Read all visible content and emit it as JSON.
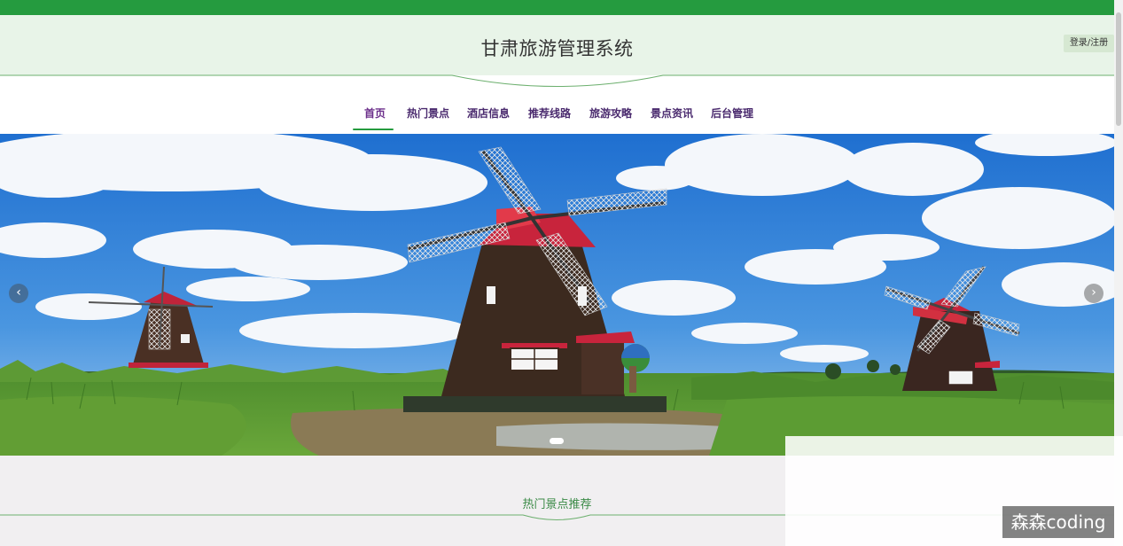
{
  "header": {
    "site_title": "甘肃旅游管理系统",
    "login_label": "登录/注册"
  },
  "nav": {
    "items": [
      {
        "label": "首页",
        "active": true
      },
      {
        "label": "热门景点"
      },
      {
        "label": "酒店信息"
      },
      {
        "label": "推荐线路"
      },
      {
        "label": "旅游攻略"
      },
      {
        "label": "景点资讯"
      },
      {
        "label": "后台管理"
      }
    ]
  },
  "banner": {
    "prev_icon": "‹",
    "next_icon": "›"
  },
  "section": {
    "title": "热门景点推荐"
  },
  "watermark": "森森coding",
  "colors": {
    "top_bar": "#259b3f",
    "header_bg": "#e8f4e8",
    "nav_text": "#4a2a6e",
    "accent_green": "#259b3f",
    "section_bg": "#f1eff1"
  }
}
